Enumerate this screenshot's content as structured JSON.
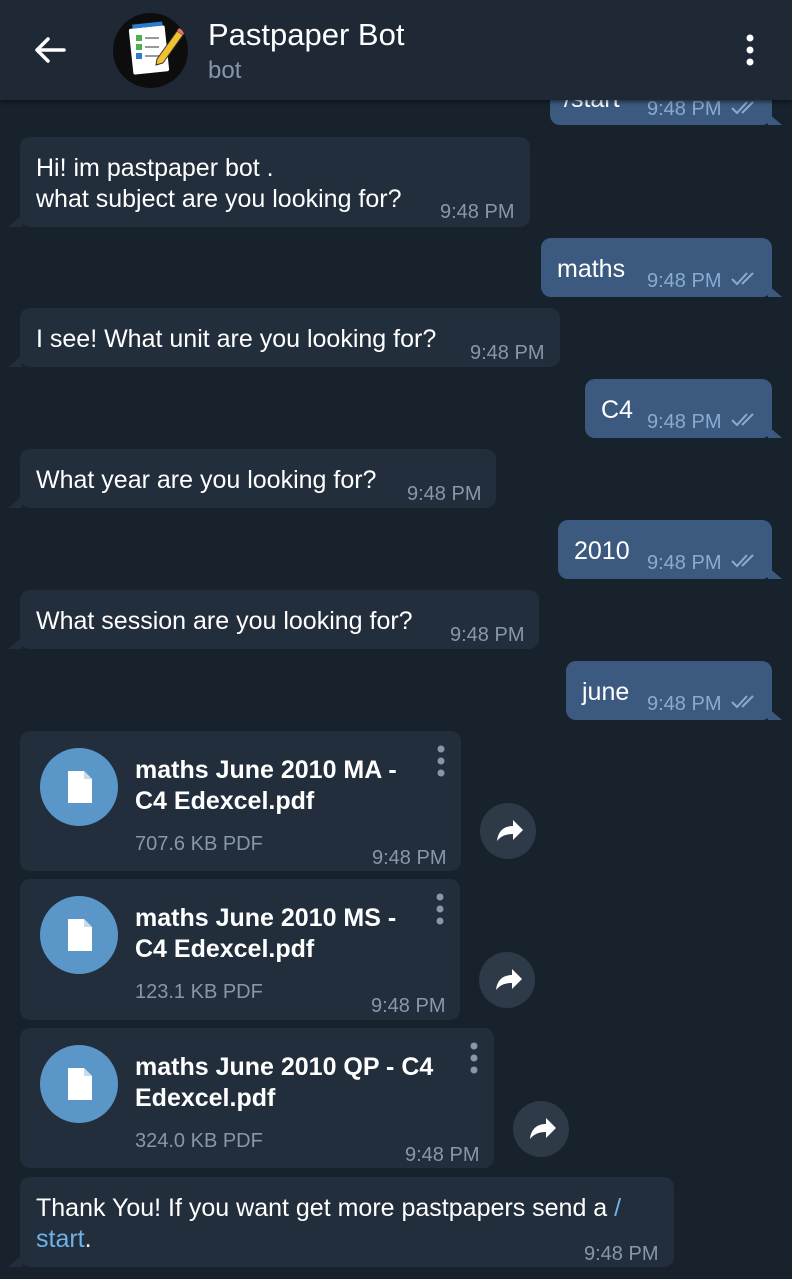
{
  "header": {
    "title": "Pastpaper Bot",
    "subtitle": "bot"
  },
  "messages": [
    {
      "dir": "out",
      "text": "/start",
      "time": "9:48 PM"
    },
    {
      "dir": "in",
      "text_line1": "Hi! im pastpaper bot .",
      "text_line2": "what subject are you looking for?",
      "time": "9:48 PM"
    },
    {
      "dir": "out",
      "text": "maths",
      "time": "9:48 PM"
    },
    {
      "dir": "in",
      "text": "I see! What unit are you looking for?",
      "time": "9:48 PM"
    },
    {
      "dir": "out",
      "text": "C4",
      "time": "9:48 PM"
    },
    {
      "dir": "in",
      "text": "What year are you looking for?",
      "time": "9:48 PM"
    },
    {
      "dir": "out",
      "text": "2010",
      "time": "9:48 PM"
    },
    {
      "dir": "in",
      "text": "What session are you looking for?",
      "time": "9:48 PM"
    },
    {
      "dir": "out",
      "text": "june",
      "time": "9:48 PM"
    }
  ],
  "files": [
    {
      "name_line1": "maths June 2010 MA -",
      "name_line2": "C4 Edexcel.pdf",
      "size": "707.6 KB PDF",
      "time": "9:48 PM"
    },
    {
      "name_line1": "maths June 2010 MS -",
      "name_line2": "C4 Edexcel.pdf",
      "size": "123.1 KB PDF",
      "time": "9:48 PM"
    },
    {
      "name_line1": "maths June 2010 QP - C4",
      "name_line2": "Edexcel.pdf",
      "size": "324.0 KB PDF",
      "time": "9:48 PM"
    }
  ],
  "final": {
    "text_line1": "Thank You! If you want get more pastpapers send a",
    "link_part1": "/",
    "link_part2": "start",
    "suffix": ".",
    "time": "9:48 PM"
  },
  "colors": {
    "background": "#18222d",
    "header": "#1f2936",
    "incoming_bubble": "#222e3b",
    "outgoing_bubble": "#3c5a7f",
    "accent": "#6fb1e8",
    "file_icon": "#5a96c8"
  },
  "icons": {
    "back": "arrow-left-icon",
    "menu": "vertical-dots-icon",
    "read": "double-check-icon",
    "file": "document-icon",
    "share": "share-arrow-icon"
  }
}
